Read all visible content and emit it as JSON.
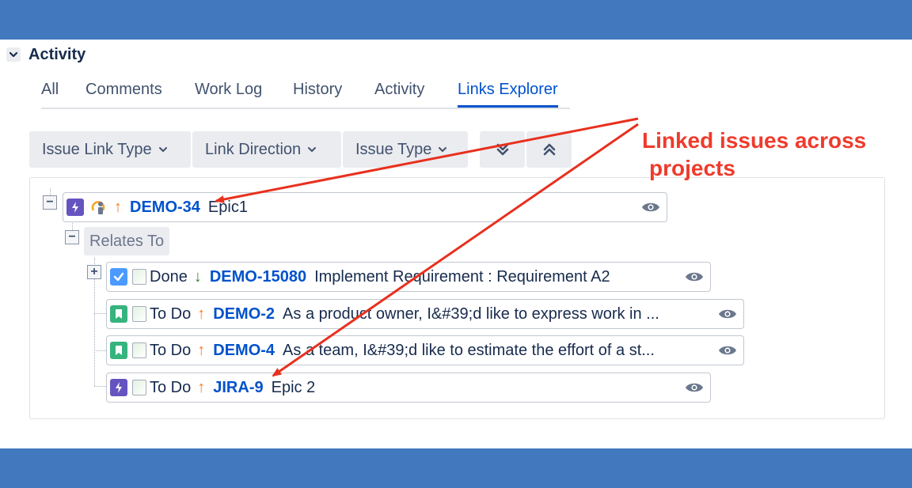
{
  "section": {
    "title": "Activity"
  },
  "tabs": [
    {
      "label": "All"
    },
    {
      "label": "Comments"
    },
    {
      "label": "Work Log"
    },
    {
      "label": "History"
    },
    {
      "label": "Activity"
    },
    {
      "label": "Links Explorer",
      "active": true
    }
  ],
  "filters": {
    "issue_link_type": "Issue Link Type",
    "link_direction": "Link Direction",
    "issue_type": "Issue Type",
    "expand_all_icon": "double-chevron-down-icon",
    "collapse_all_icon": "double-chevron-up-icon"
  },
  "tree": {
    "root": {
      "type": "epic",
      "priority": "up",
      "key": "DEMO-34",
      "summary": "Epic1"
    },
    "link_group": {
      "label": "Relates To"
    },
    "children": [
      {
        "type": "task",
        "status_alt": "Done",
        "priority": "down",
        "key": "DEMO-15080",
        "summary": "Implement Requirement : Requirement A2"
      },
      {
        "type": "story",
        "status_alt": "To Do",
        "priority": "up",
        "key": "DEMO-2",
        "summary": "As a product owner, I&#39;d like to express work in ..."
      },
      {
        "type": "story",
        "status_alt": "To Do",
        "priority": "up",
        "key": "DEMO-4",
        "summary": "As a team, I&#39;d like to estimate the effort of a st..."
      },
      {
        "type": "epic",
        "status_alt": "To Do",
        "priority": "up",
        "key": "JIRA-9",
        "summary": "Epic 2"
      }
    ]
  },
  "annotation": {
    "line1": "Linked issues across",
    "line2": "projects"
  },
  "colors": {
    "frame": "#4178be",
    "link": "#0052cc",
    "annotation": "#ef3b2c",
    "epic": "#6554c0",
    "story": "#36b37e",
    "task": "#4c9aff",
    "priority_up": "#ff7a1a",
    "priority_down": "#2e8b3a"
  }
}
